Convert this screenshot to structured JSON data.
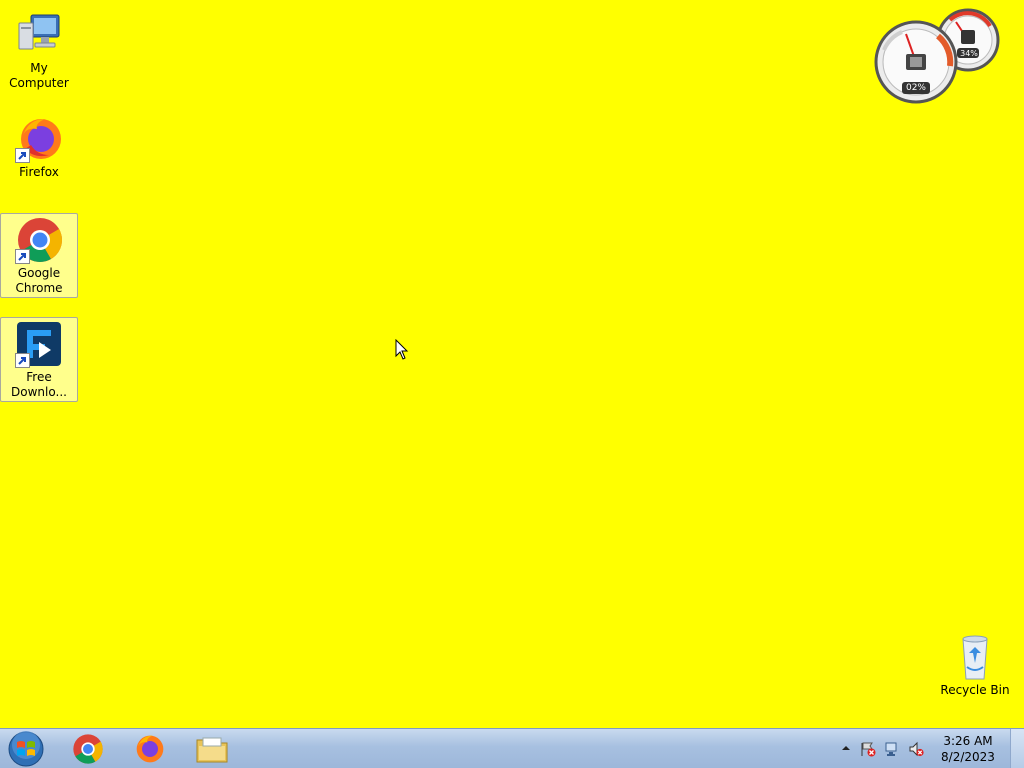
{
  "desktop": {
    "background_color": "#ffff00",
    "icons": [
      {
        "label": "My Computer",
        "icon": "computer-icon"
      },
      {
        "label": "Firefox",
        "icon": "firefox-icon"
      },
      {
        "label": "Google Chrome",
        "icon": "chrome-icon"
      },
      {
        "label": "Free Downlo...",
        "icon": "free-download-manager-icon"
      },
      {
        "label": "Recycle Bin",
        "icon": "recycle-bin-icon"
      }
    ]
  },
  "gadget": {
    "cpu_percent": "02%",
    "memory_percent": "34%"
  },
  "taskbar": {
    "pinned": [
      {
        "icon": "chrome-icon"
      },
      {
        "icon": "firefox-icon"
      },
      {
        "icon": "folder-icon"
      }
    ],
    "clock": {
      "time": "3:26 AM",
      "date": "8/2/2023"
    }
  }
}
